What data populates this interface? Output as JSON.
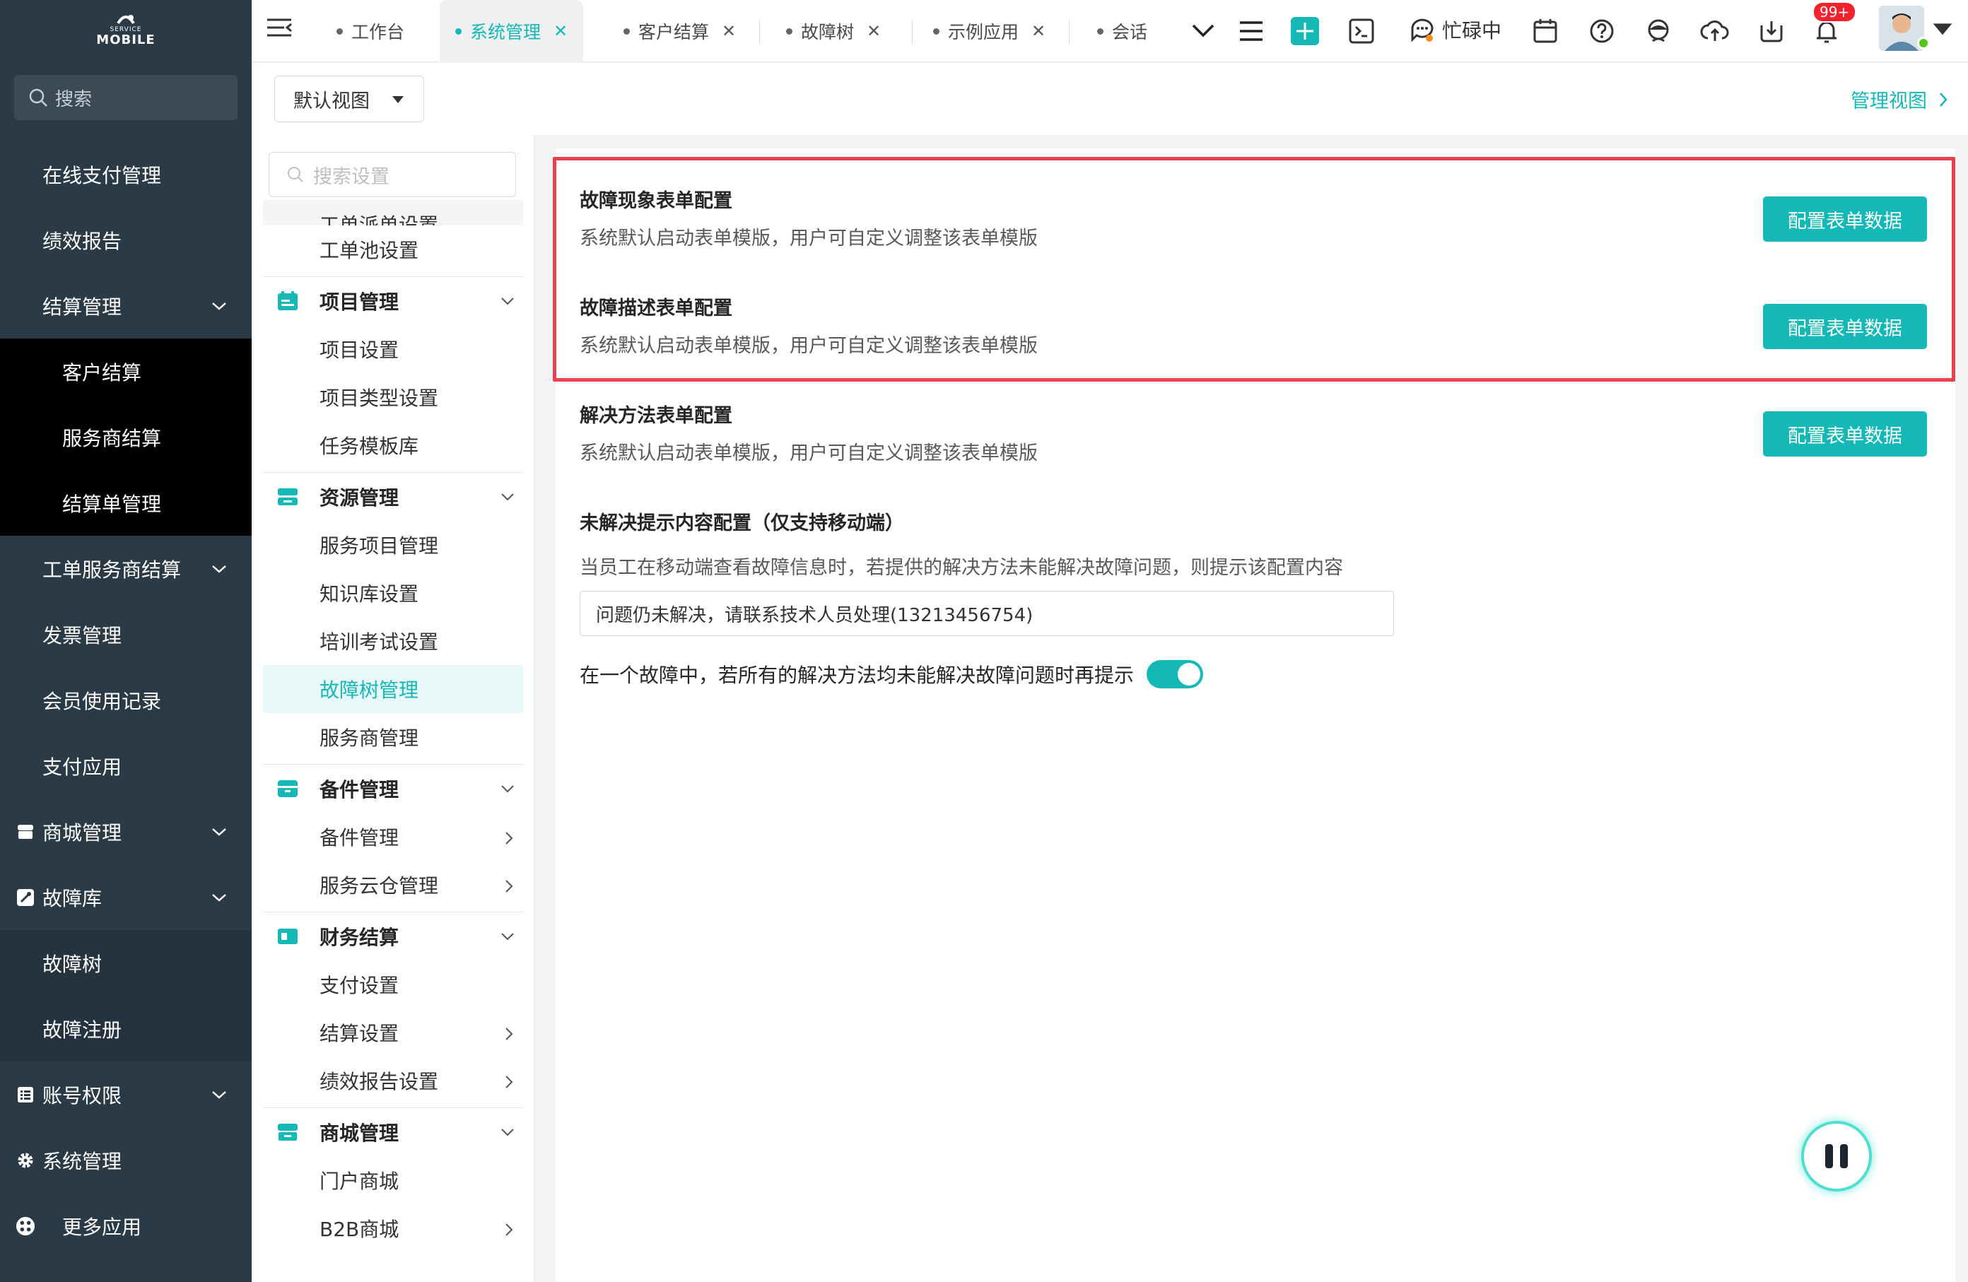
{
  "sidebar": {
    "logo_small": "SERVICE",
    "logo_big": "MOBILE",
    "search_placeholder": "搜索",
    "items": [
      {
        "label": "在线支付管理"
      },
      {
        "label": "绩效报告"
      },
      {
        "label": "结算管理"
      },
      {
        "label": "客户结算"
      },
      {
        "label": "服务商结算"
      },
      {
        "label": "结算单管理"
      },
      {
        "label": "工单服务商结算"
      },
      {
        "label": "发票管理"
      },
      {
        "label": "会员使用记录"
      },
      {
        "label": "支付应用"
      },
      {
        "label": "商城管理"
      },
      {
        "label": "故障库"
      },
      {
        "label": "故障树"
      },
      {
        "label": "故障注册"
      },
      {
        "label": "账号权限"
      },
      {
        "label": "系统管理"
      },
      {
        "label": "更多应用"
      }
    ]
  },
  "tabs": [
    {
      "label": "工作台"
    },
    {
      "label": "系统管理"
    },
    {
      "label": "客户结算"
    },
    {
      "label": "故障树"
    },
    {
      "label": "示例应用"
    },
    {
      "label": "会话"
    }
  ],
  "topbar": {
    "status": "忙碌中",
    "badge": "99+",
    "accent": "#14b8b6"
  },
  "viewbar": {
    "view_select": "默认视图",
    "manage_link": "管理视图"
  },
  "subnav": {
    "search_placeholder": "搜索设置",
    "cut_item": "工单派单设置",
    "entries": [
      {
        "label": "工单池设置"
      },
      {
        "label": "项目管理"
      },
      {
        "label": "项目设置"
      },
      {
        "label": "项目类型设置"
      },
      {
        "label": "任务模板库"
      },
      {
        "label": "资源管理"
      },
      {
        "label": "服务项目管理"
      },
      {
        "label": "知识库设置"
      },
      {
        "label": "培训考试设置"
      },
      {
        "label": "故障树管理"
      },
      {
        "label": "服务商管理"
      },
      {
        "label": "备件管理"
      },
      {
        "label": "备件管理"
      },
      {
        "label": "服务云仓管理"
      },
      {
        "label": "财务结算"
      },
      {
        "label": "支付设置"
      },
      {
        "label": "结算设置"
      },
      {
        "label": "绩效报告设置"
      },
      {
        "label": "商城管理"
      },
      {
        "label": "门户商城"
      },
      {
        "label": "B2B商城"
      }
    ]
  },
  "main": {
    "configs": [
      {
        "title": "故障现象表单配置",
        "desc": "系统默认启动表单模版，用户可自定义调整该表单模版",
        "button": "配置表单数据"
      },
      {
        "title": "故障描述表单配置",
        "desc": "系统默认启动表单模版，用户可自定义调整该表单模版",
        "button": "配置表单数据"
      },
      {
        "title": "解决方法表单配置",
        "desc": "系统默认启动表单模版，用户可自定义调整该表单模版",
        "button": "配置表单数据"
      }
    ],
    "unresolved": {
      "title": "未解决提示内容配置（仅支持移动端）",
      "desc": "当员工在移动端查看故障信息时，若提供的解决方法未能解决故障问题，则提示该配置内容",
      "input_value": "问题仍未解决，请联系技术人员处理(13213456754)",
      "toggle_label": "在一个故障中，若所有的解决方法均未能解决故障问题时再提示",
      "toggle_on": true
    }
  }
}
